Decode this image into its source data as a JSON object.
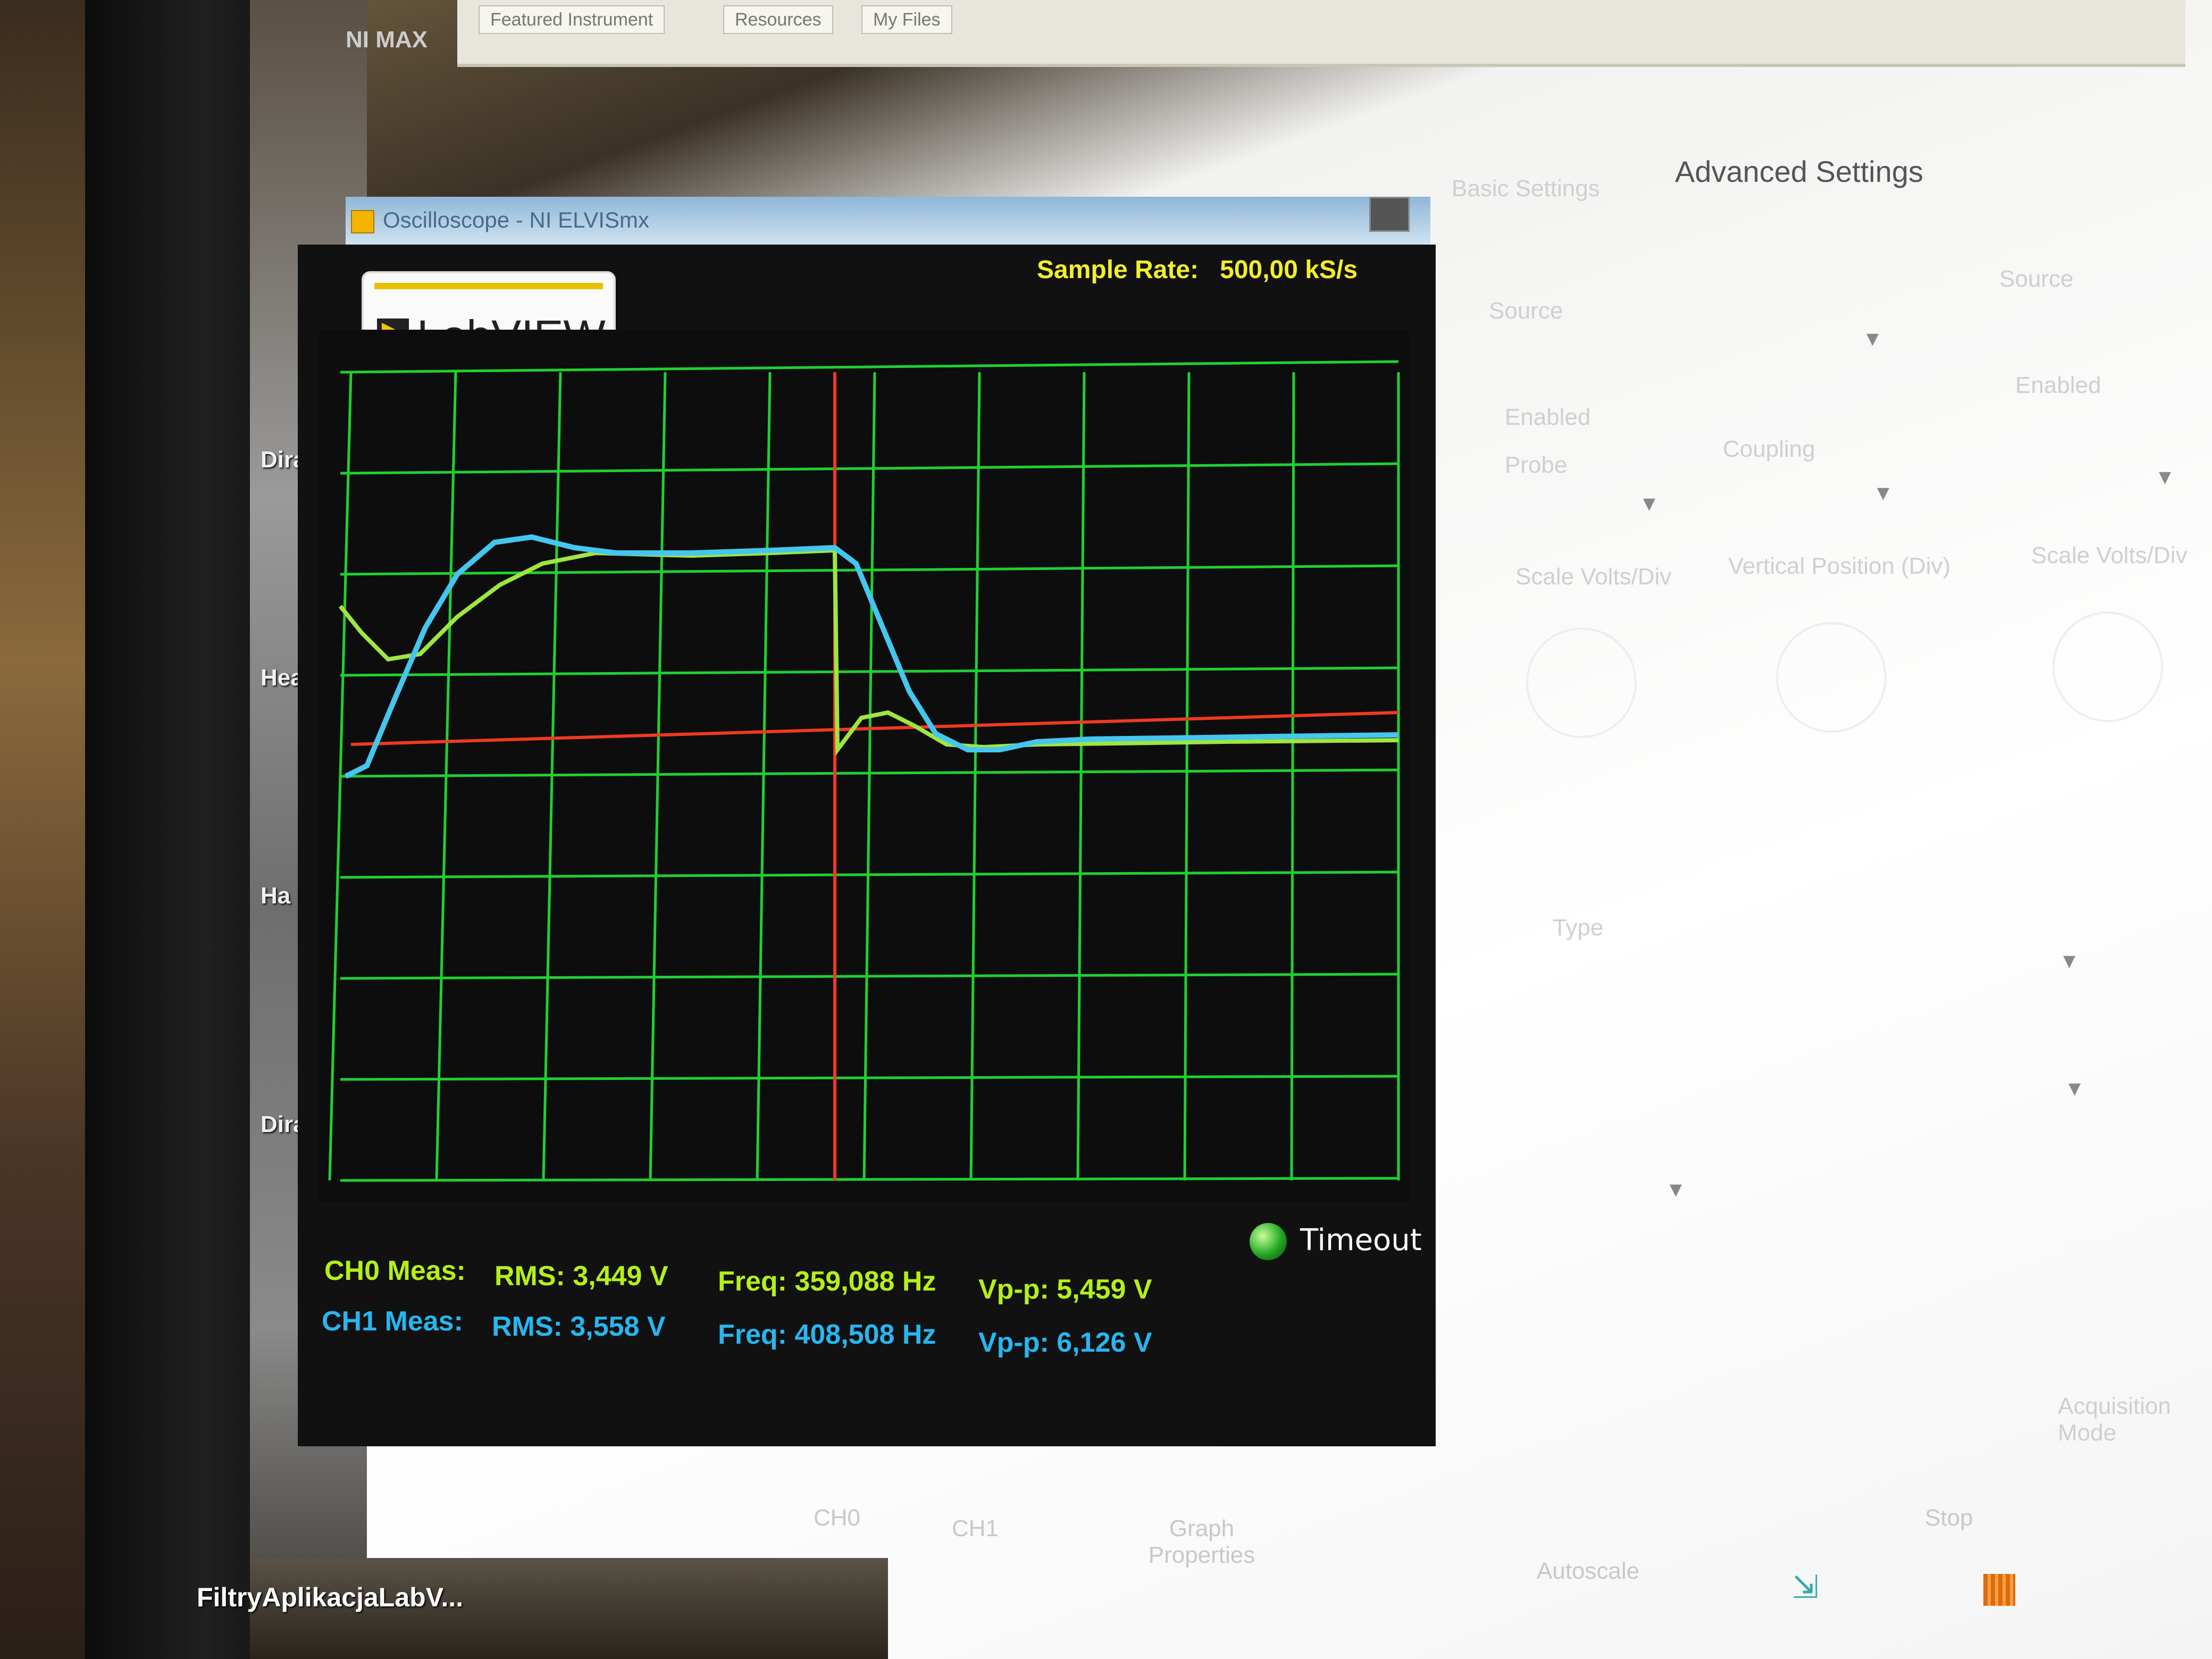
{
  "desktop": {
    "icons": [
      "NI MAX",
      "Dirac",
      "Heavy",
      "Ha",
      "Dirac"
    ],
    "taskbar_label": "FiltryAplikacjaLabV..."
  },
  "background_app": {
    "tabs": [
      "Featured Instrument",
      "Resources",
      "My Files"
    ]
  },
  "window": {
    "title": "Oscilloscope - NI ELVISmx",
    "logo_text": "LabVIEW",
    "sample_rate_label": "Sample Rate:",
    "sample_rate_value": "500,00 kS/s"
  },
  "measurements": {
    "ch0": {
      "label": "CH0 Meas:",
      "rms_label": "RMS:",
      "rms": "3,449 V",
      "freq_label": "Freq:",
      "freq": "359,088 Hz",
      "vpp_label": "Vp-p:",
      "vpp": "5,459 V",
      "color": "#b4f018"
    },
    "ch1": {
      "label": "CH1 Meas:",
      "rms_label": "RMS:",
      "rms": "3,558 V",
      "freq_label": "Freq:",
      "freq": "408,508 Hz",
      "vpp_label": "Vp-p:",
      "vpp": "6,126 V",
      "color": "#28b6f0"
    }
  },
  "timeout_label": "Timeout",
  "settings": {
    "tabs": [
      "Basic Settings",
      "Advanced Settings"
    ],
    "source_label": "Source",
    "enabled_label": "Enabled",
    "probe_label": "Probe",
    "coupling_label": "Coupling",
    "scale_label": "Scale Volts/Div",
    "position_label": "Vertical Position (Div)",
    "type_label": "Type",
    "acquisition_label": "Acquisition Mode"
  },
  "bottom_bar": {
    "buttons": [
      "CH0",
      "CH1",
      "Graph Properties",
      "Autoscale",
      "Stop"
    ]
  },
  "colors": {
    "grid": "#20d030",
    "ch0_trace": "#9ee640",
    "ch1_trace": "#44c6ee",
    "cursor": "#f03a20",
    "panel_bg": "#111111"
  }
}
